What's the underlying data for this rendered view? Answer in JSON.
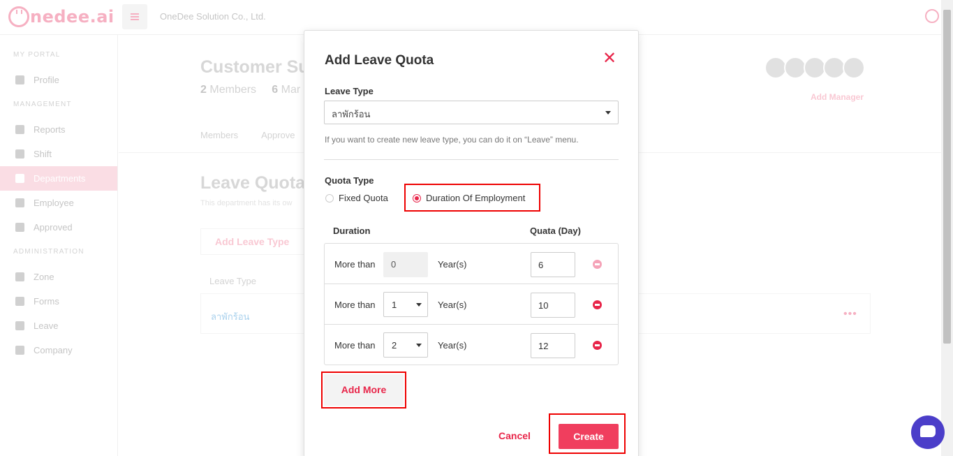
{
  "topbar": {
    "logo_text": "nedee.ai",
    "company": "OneDee Solution Co., Ltd."
  },
  "sidebar": {
    "sections": {
      "my_portal": "MY PORTAL",
      "management": "MANAGEMENT",
      "administration": "ADMINISTRATION"
    },
    "items": [
      {
        "label": "Profile",
        "icon": "user-circle-icon"
      },
      {
        "label": "Reports",
        "icon": "file-icon"
      },
      {
        "label": "Shift",
        "icon": "truck-icon"
      },
      {
        "label": "Departments",
        "icon": "users-icon",
        "active": true
      },
      {
        "label": "Employee",
        "icon": "id-card-icon"
      },
      {
        "label": "Approved",
        "icon": "inbox-icon"
      },
      {
        "label": "Zone",
        "icon": "map-pin-icon"
      },
      {
        "label": "Forms",
        "icon": "clipboard-icon"
      },
      {
        "label": "Leave",
        "icon": "x-circle-icon"
      },
      {
        "label": "Company",
        "icon": "building-icon"
      }
    ]
  },
  "page": {
    "title": "Customer Su",
    "members_count": "2",
    "members_label": "Members",
    "managers_count": "6",
    "managers_label": "Mar",
    "tabs": [
      "Members",
      "Approve"
    ],
    "add_manager": "Add Manager",
    "leave_quota_title": "Leave Quota",
    "leave_quota_desc": "This department has its ow",
    "add_leave_type": "Add Leave Type",
    "table_header": "Leave Type",
    "table_row": "ลาพักร้อน",
    "row_menu": "•••"
  },
  "modal": {
    "title": "Add Leave Quota",
    "close": "✕",
    "leave_type_label": "Leave Type",
    "leave_type_value": "ลาพักร้อน",
    "hint": "If you want to create new leave type, you can do it on “Leave” menu.",
    "quota_type_label": "Quota Type",
    "quota_options": [
      {
        "label": "Fixed Quota",
        "checked": false
      },
      {
        "label": "Duration Of Employment",
        "checked": true
      }
    ],
    "col_duration": "Duration",
    "col_quota": "Quata (Day)",
    "rows": [
      {
        "more_than": "More than",
        "years": "0",
        "unit": "Year(s)",
        "quota": "6",
        "editable": false
      },
      {
        "more_than": "More than",
        "years": "1",
        "unit": "Year(s)",
        "quota": "10",
        "editable": true
      },
      {
        "more_than": "More than",
        "years": "2",
        "unit": "Year(s)",
        "quota": "12",
        "editable": true
      }
    ],
    "add_more": "Add More",
    "cancel": "Cancel",
    "create": "Create"
  },
  "colors": {
    "accent": "#e8264a",
    "highlight": "#ee0000",
    "chat": "#4b3ec9"
  }
}
